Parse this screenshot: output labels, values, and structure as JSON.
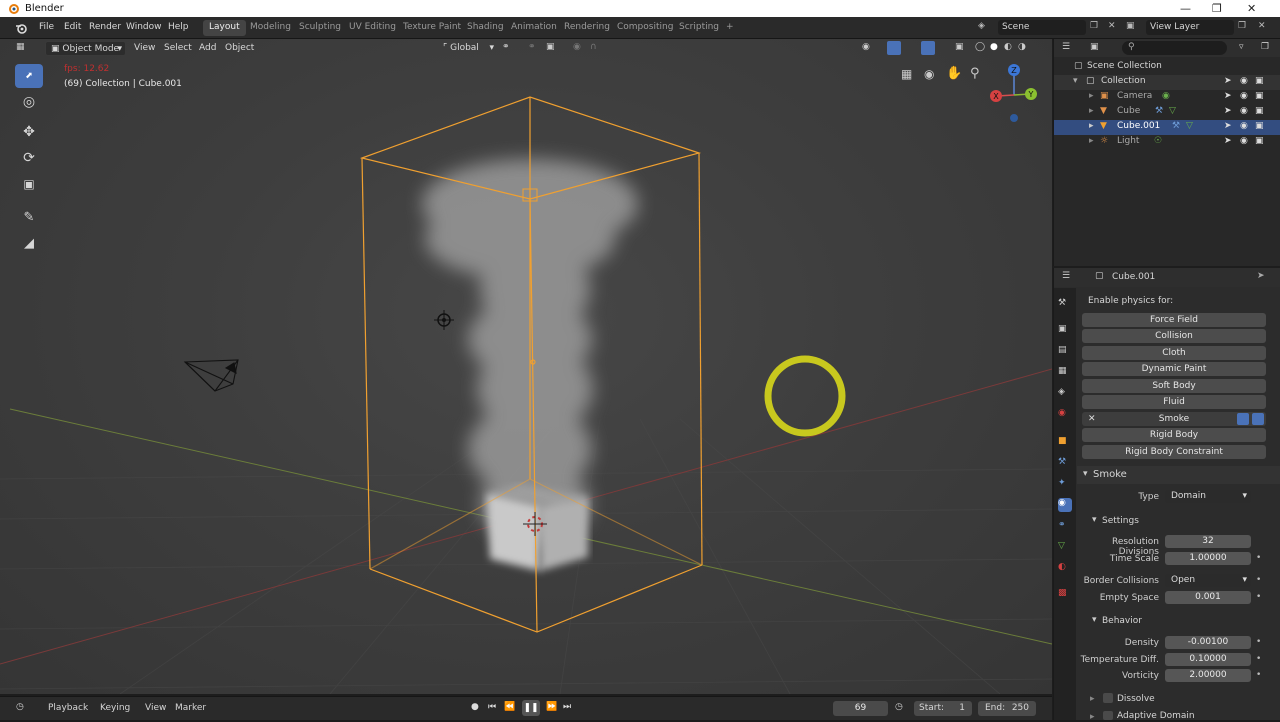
{
  "window": {
    "title": "Blender"
  },
  "menus": [
    "File",
    "Edit",
    "Render",
    "Window",
    "Help"
  ],
  "workspaces": [
    {
      "label": "Layout",
      "active": true
    },
    {
      "label": "Modeling"
    },
    {
      "label": "Sculpting"
    },
    {
      "label": "UV Editing"
    },
    {
      "label": "Texture Paint"
    },
    {
      "label": "Shading"
    },
    {
      "label": "Animation"
    },
    {
      "label": "Rendering"
    },
    {
      "label": "Compositing"
    },
    {
      "label": "Scripting"
    },
    {
      "label": "+"
    }
  ],
  "scene": {
    "name": "Scene"
  },
  "view_layer": {
    "name": "View Layer"
  },
  "viewport": {
    "mode": "Object Mode",
    "menus": [
      "View",
      "Select",
      "Add",
      "Object"
    ],
    "orientation": "Global",
    "fps": "fps: 12.62",
    "info": "(69) Collection | Cube.001",
    "gizmo": {
      "x": "X",
      "y": "Y",
      "z": "Z"
    }
  },
  "outliner": {
    "root": "Scene Collection",
    "collection": "Collection",
    "items": [
      {
        "name": "Camera",
        "icon": "camera-icon",
        "color": "#e0914a"
      },
      {
        "name": "Cube",
        "icon": "mesh-icon",
        "color": "#e0914a"
      },
      {
        "name": "Cube.001",
        "icon": "mesh-icon",
        "color": "#e0914a"
      },
      {
        "name": "Light",
        "icon": "light-icon",
        "color": "#e0914a"
      }
    ]
  },
  "properties": {
    "object": "Cube.001",
    "enable_label": "Enable physics for:",
    "buttons": [
      "Force Field",
      "Collision",
      "Cloth",
      "Dynamic Paint",
      "Soft Body",
      "Fluid",
      "Smoke",
      "Rigid Body",
      "Rigid Body Constraint"
    ],
    "smoke": {
      "header": "Smoke",
      "type_label": "Type",
      "type_value": "Domain",
      "settings_header": "Settings",
      "res_label": "Resolution Divisions",
      "res_value": "32",
      "time_label": "Time Scale",
      "time_value": "1.00000",
      "border_label": "Border Collisions",
      "border_value": "Open",
      "empty_label": "Empty Space",
      "empty_value": "0.001",
      "behavior_header": "Behavior",
      "density_label": "Density",
      "density_value": "-0.00100",
      "temp_label": "Temperature Diff.",
      "temp_value": "0.10000",
      "vort_label": "Vorticity",
      "vort_value": "2.00000",
      "dissolve_label": "Dissolve",
      "adaptive_label": "Adaptive Domain"
    }
  },
  "timeline": {
    "menus": [
      "Playback",
      "Keying",
      "View",
      "Marker"
    ],
    "frame": "69",
    "start_label": "Start:",
    "start": "1",
    "end_label": "End:",
    "end": "250"
  },
  "colors": {
    "accent": "#4a72b8",
    "selection": "#f0a030",
    "light": "#c8c81e"
  }
}
